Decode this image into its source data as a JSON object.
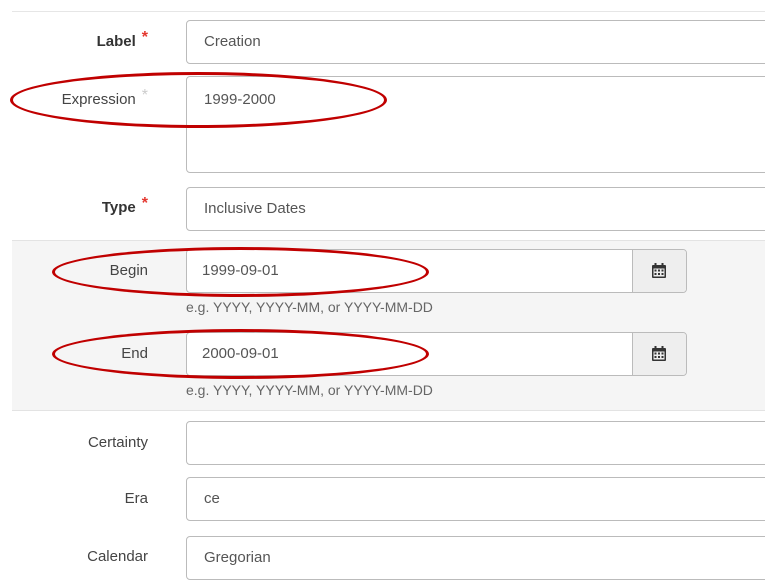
{
  "colors": {
    "required_asterisk": "#e4372f",
    "optional_asterisk": "#cccccc",
    "annotation": "#c00000"
  },
  "form": {
    "label": {
      "label": "Label",
      "asterisk": "*",
      "value": "Creation"
    },
    "expression": {
      "label": "Expression",
      "asterisk": "*",
      "value": "1999-2000"
    },
    "type": {
      "label": "Type",
      "asterisk": "*",
      "value": "Inclusive Dates"
    },
    "begin": {
      "label": "Begin",
      "value": "1999-09-01",
      "help": "e.g. YYYY, YYYY-MM, or YYYY-MM-DD",
      "button_icon": "calendar-icon"
    },
    "end": {
      "label": "End",
      "value": "2000-09-01",
      "help": "e.g. YYYY, YYYY-MM, or YYYY-MM-DD",
      "button_icon": "calendar-icon"
    },
    "certainty": {
      "label": "Certainty",
      "value": ""
    },
    "era": {
      "label": "Era",
      "value": "ce"
    },
    "calendar": {
      "label": "Calendar",
      "value": "Gregorian"
    }
  }
}
